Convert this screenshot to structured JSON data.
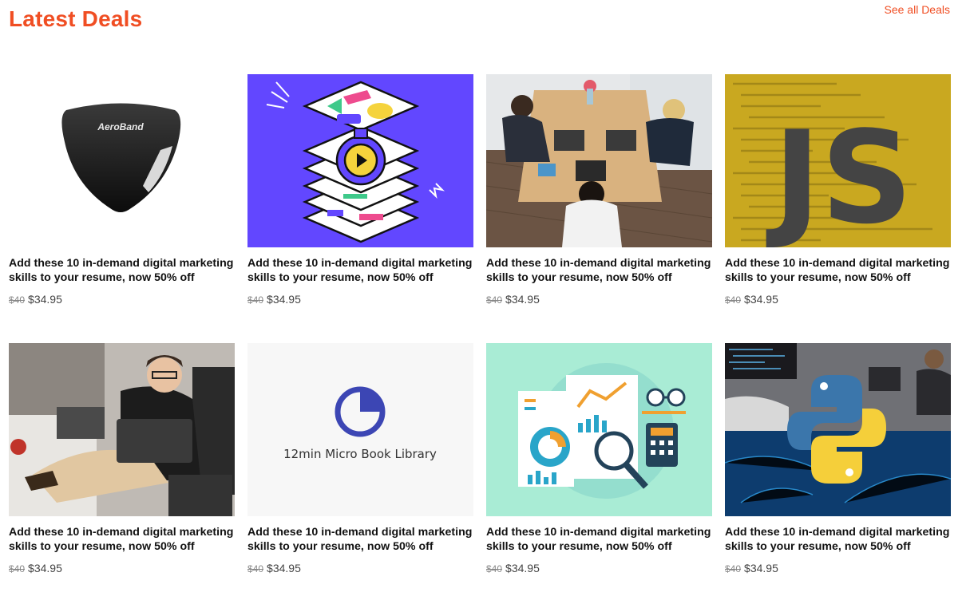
{
  "header": {
    "title": "Latest Deals",
    "see_all": "See all Deals",
    "accent_color": "#f04e23"
  },
  "deals": [
    {
      "title": "Add these 10 in-demand digital marketing skills to your resume, now 50% off",
      "old_price": "$40",
      "price": "$34.95",
      "image": "aeroband-device"
    },
    {
      "title": "Add these 10 in-demand digital marketing skills to your resume, now 50% off",
      "old_price": "$40",
      "price": "$34.95",
      "image": "video-layers-illustration"
    },
    {
      "title": "Add these 10 in-demand digital marketing skills to your resume, now 50% off",
      "old_price": "$40",
      "price": "$34.95",
      "image": "team-at-table-photo"
    },
    {
      "title": "Add these 10 in-demand digital marketing skills to your resume, now 50% off",
      "old_price": "$40",
      "price": "$34.95",
      "image": "javascript-logo"
    },
    {
      "title": "Add these 10 in-demand digital marketing skills to your resume, now 50% off",
      "old_price": "$40",
      "price": "$34.95",
      "image": "man-with-laptop-photo"
    },
    {
      "title": "Add these 10 in-demand digital marketing skills to your resume, now 50% off",
      "old_price": "$40",
      "price": "$34.95",
      "image": "12min-logo",
      "image_text": "12min Micro Book Library"
    },
    {
      "title": "Add these 10 in-demand digital marketing skills to your resume, now 50% off",
      "old_price": "$40",
      "price": "$34.95",
      "image": "analytics-illustration"
    },
    {
      "title": "Add these 10 in-demand digital marketing skills to your resume, now 50% off",
      "old_price": "$40",
      "price": "$34.95",
      "image": "python-logo"
    }
  ],
  "images": {
    "aeroband_text": "AeroBand",
    "js_text": "JS"
  }
}
